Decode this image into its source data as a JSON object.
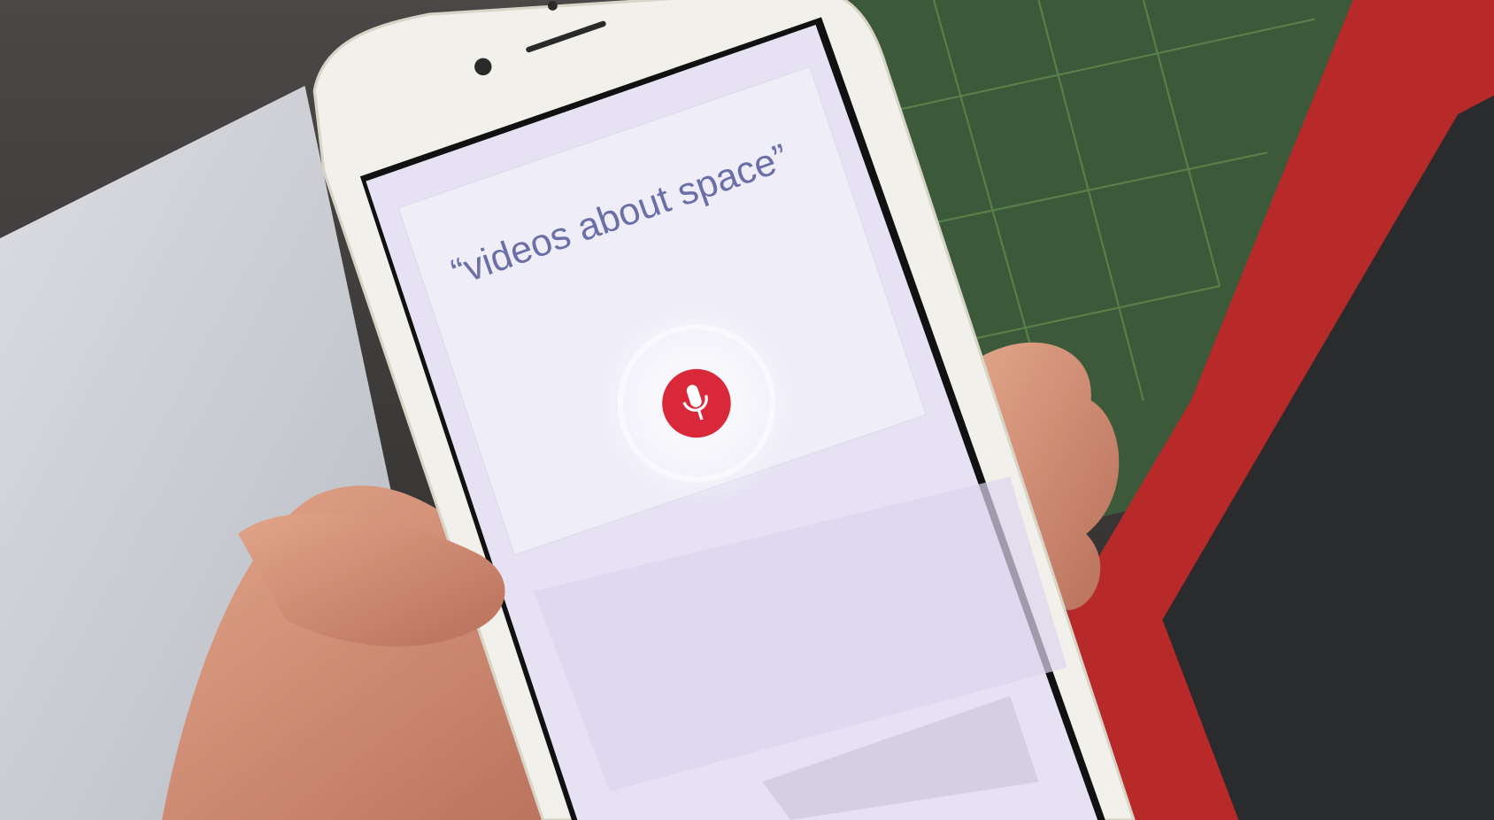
{
  "voice_search": {
    "query_text": "“videos about space”",
    "mic_button_icon": "microphone-icon",
    "mic_color": "#d9283a"
  },
  "colors": {
    "screen_tint": "#e6e2f4",
    "card": "#eeedf8",
    "phone_body": "#f2f0ea",
    "cutting_mat": "#3c5a3a",
    "box_red": "#b8292a"
  }
}
